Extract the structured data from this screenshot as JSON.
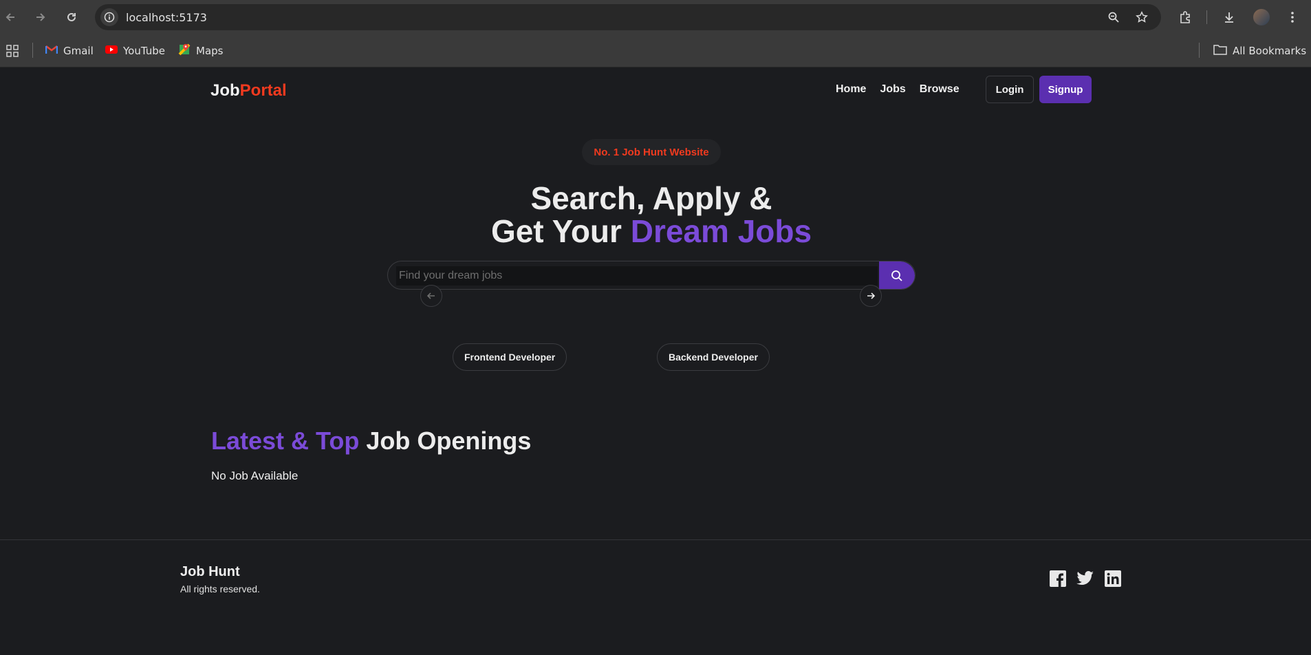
{
  "browser": {
    "url": "localhost:5173",
    "bookmarks": [
      {
        "label": "Gmail",
        "icon": "gmail-icon"
      },
      {
        "label": "YouTube",
        "icon": "youtube-icon"
      },
      {
        "label": "Maps",
        "icon": "maps-icon"
      }
    ],
    "all_bookmarks_label": "All Bookmarks"
  },
  "header": {
    "logo_part1": "Job",
    "logo_part2": "Portal",
    "nav": [
      "Home",
      "Jobs",
      "Browse"
    ],
    "login_label": "Login",
    "signup_label": "Signup"
  },
  "hero": {
    "badge": "No. 1 Job Hunt Website",
    "line1": "Search, Apply &",
    "line2_plain": "Get Your ",
    "line2_accent": "Dream Jobs",
    "search_placeholder": "Find your dream jobs"
  },
  "carousel": {
    "items": [
      "Frontend Developer",
      "Backend Developer"
    ]
  },
  "latest": {
    "title_accent": "Latest & Top ",
    "title_plain": "Job Openings",
    "empty_text": "No Job Available"
  },
  "footer": {
    "title": "Job Hunt",
    "subtitle": "All rights reserved."
  },
  "colors": {
    "brand_purple": "#5b2fb0",
    "accent_purple": "#7b4bd8",
    "accent_red": "#f23a1f",
    "background": "#1b1c1f"
  }
}
